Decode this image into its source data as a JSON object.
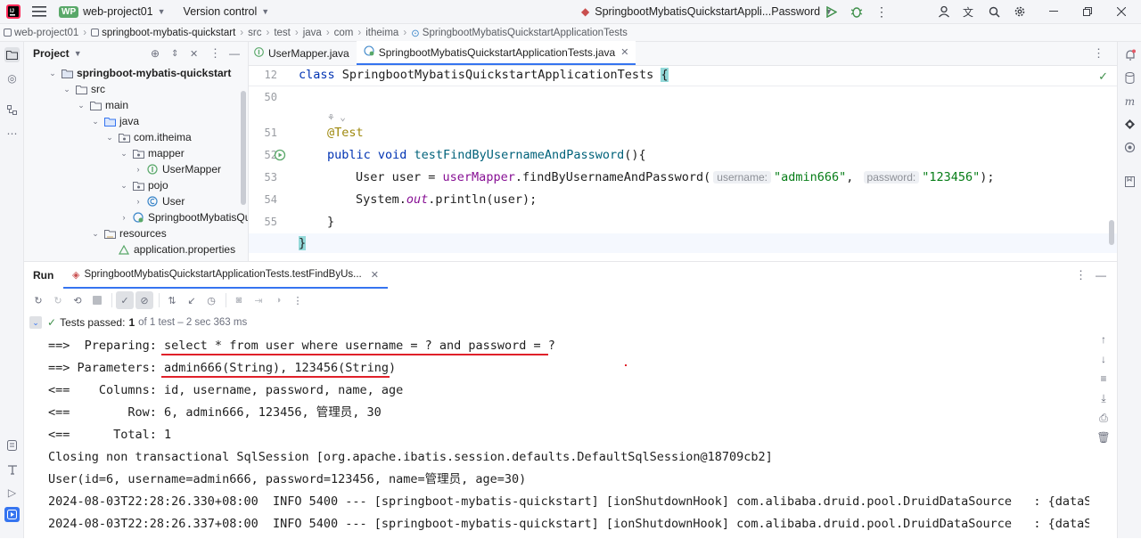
{
  "titlebar": {
    "project_badge": "WP",
    "project_name": "web-project01",
    "vcs_label": "Version control",
    "run_config": "SpringbootMybatisQuickstartAppli...Password"
  },
  "breadcrumb": {
    "items": [
      "web-project01",
      "springboot-mybatis-quickstart",
      "src",
      "test",
      "java",
      "com",
      "itheima",
      "SpringbootMybatisQuickstartApplicationTests"
    ]
  },
  "project_panel": {
    "title": "Project",
    "tree": [
      {
        "label": "springboot-mybatis-quickstart",
        "bold": true
      },
      {
        "label": "src"
      },
      {
        "label": "main"
      },
      {
        "label": "java"
      },
      {
        "label": "com.itheima"
      },
      {
        "label": "mapper"
      },
      {
        "label": "UserMapper"
      },
      {
        "label": "pojo"
      },
      {
        "label": "User"
      },
      {
        "label": "SpringbootMybatisQui"
      },
      {
        "label": "resources"
      },
      {
        "label": "application.properties"
      }
    ]
  },
  "editor": {
    "tabs": [
      {
        "label": "UserMapper.java",
        "active": false
      },
      {
        "label": "SpringbootMybatisQuickstartApplicationTests.java",
        "active": true
      }
    ],
    "line_numbers": [
      "12",
      "50",
      "51",
      "52",
      "53",
      "54",
      "55",
      "56"
    ],
    "code": {
      "l12_kw": "class",
      "l12_name": " SpringbootMybatisQuickstartApplicationTests ",
      "l12_brace": "{",
      "l51_ann": "@Test",
      "l52_kw": "public void",
      "l52_name": " testFindByUsernameAndPassword",
      "l52_rest": "(){",
      "l53_a": "User user = ",
      "l53_field": "userMapper",
      "l53_call": ".findByUsernameAndPassword(",
      "l53_hint1": "username:",
      "l53_str1": "\"admin666\"",
      "l53_comma": ", ",
      "l53_hint2": "password:",
      "l53_str2": "\"123456\"",
      "l53_end": ");",
      "l54_a": "System.",
      "l54_out": "out",
      "l54_b": ".println(user);",
      "l55": "}",
      "l56": "}"
    }
  },
  "run_panel": {
    "title": "Run",
    "tab_label": "SpringbootMybatisQuickstartApplicationTests.testFindByUs...",
    "status_prefix": "Tests passed:",
    "status_count": "1",
    "status_suffix": "of 1 test – 2 sec 363 ms",
    "console_lines": [
      "==>  Preparing: select * from user where username = ? and password = ?",
      "==> Parameters: admin666(String), 123456(String)",
      "<==    Columns: id, username, password, name, age",
      "<==        Row: 6, admin666, 123456, 管理员, 30",
      "<==      Total: 1",
      "Closing non transactional SqlSession [org.apache.ibatis.session.defaults.DefaultSqlSession@18709cb2]",
      "User(id=6, username=admin666, password=123456, name=管理员, age=30)",
      "2024-08-03T22:28:26.330+08:00  INFO 5400 --- [springboot-mybatis-quickstart] [ionShutdownHook] com.alibaba.druid.pool.DruidDataSource   : {dataSou",
      "2024-08-03T22:28:26.337+08:00  INFO 5400 --- [springboot-mybatis-quickstart] [ionShutdownHook] com.alibaba.druid.pool.DruidDataSource   : {dataSou"
    ]
  },
  "colors": {
    "accent": "#3574f0",
    "success": "#3e8f4a",
    "annotation_red": "#e0202a"
  }
}
